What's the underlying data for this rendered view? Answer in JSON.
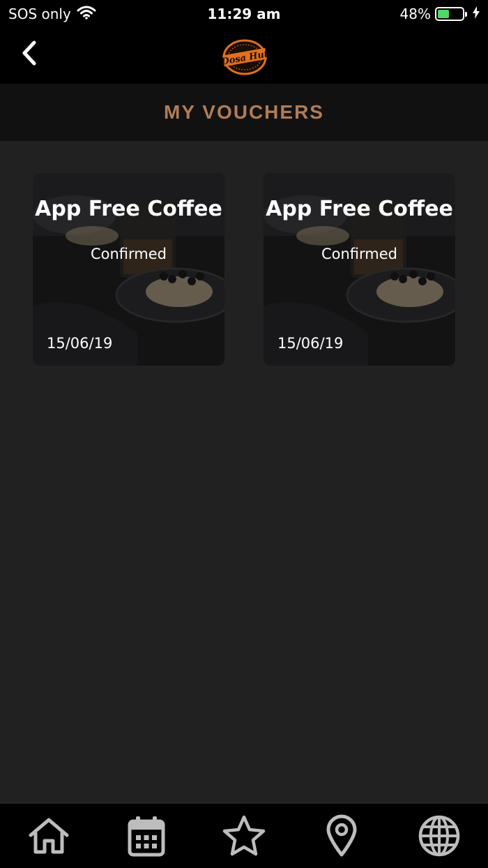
{
  "status_bar": {
    "carrier": "SOS only",
    "time": "11:29 am",
    "battery_percent": "48%",
    "battery_level": 0.48,
    "icons": [
      "wifi-icon",
      "battery-icon",
      "charging-bolt-icon"
    ]
  },
  "nav": {
    "back_icon": "chevron-left-icon",
    "logo_text": "Dosa Hut"
  },
  "header": {
    "title": "MY VOUCHERS",
    "title_color": "#b07d56"
  },
  "vouchers": [
    {
      "title": "App Free Coffee",
      "status": "Confirmed",
      "date": "15/06/19"
    },
    {
      "title": "App Free Coffee",
      "status": "Confirmed",
      "date": "15/06/19"
    }
  ],
  "tab_bar": {
    "tabs": [
      {
        "icon": "home-icon"
      },
      {
        "icon": "calendar-icon"
      },
      {
        "icon": "star-icon"
      },
      {
        "icon": "location-pin-icon"
      },
      {
        "icon": "globe-icon"
      }
    ],
    "icon_color": "#bdbdbd"
  },
  "colors": {
    "background": "#212121",
    "bar_background": "#000000",
    "title_bar_background": "#121112",
    "logo_orange": "#e2701f"
  }
}
